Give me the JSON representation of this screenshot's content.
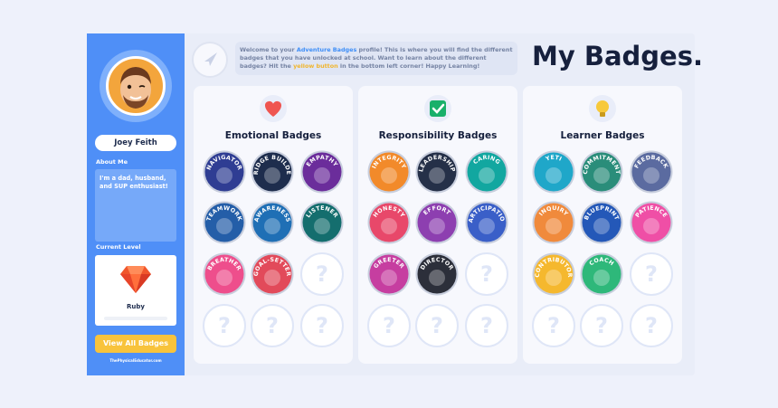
{
  "sidebar": {
    "user_name": "Joey Feith",
    "about_label": "About Me",
    "about_text": "I'm a dad, husband, and SUP enthusiast!",
    "level_label": "Current Level",
    "level_name": "Ruby",
    "level_progress": 0,
    "view_button": "View All Badges",
    "footer": "ThePhysicalEducator.com"
  },
  "header": {
    "welcome_1": "Welcome to your ",
    "welcome_link": "Adventure Badges",
    "welcome_2": " profile! This is where you will find the different badges that you have unlocked at school. Want to learn about the different badges? Hit the ",
    "welcome_button": "yellow button",
    "welcome_3": " in the bottom left corner! Happy Learning!",
    "title": "My Badges."
  },
  "categories": [
    {
      "title": "Emotional Badges",
      "icon": "heart-icon",
      "badges": [
        {
          "label": "NAVIGATOR",
          "color": "#2f3d93",
          "locked": false
        },
        {
          "label": "BRIDGE BUILDER",
          "color": "#1e2d4d",
          "locked": false
        },
        {
          "label": "EMPATHY",
          "color": "#6b2d9b",
          "locked": false
        },
        {
          "label": "TEAMWORK",
          "color": "#245ea8",
          "locked": false
        },
        {
          "label": "AWARENESS",
          "color": "#1f6fb5",
          "locked": false
        },
        {
          "label": "LISTENER",
          "color": "#146e6e",
          "locked": false
        },
        {
          "label": "BREATHER",
          "color": "#ee4e8c",
          "locked": false
        },
        {
          "label": "GOAL-SETTER",
          "color": "#e24a5a",
          "locked": false
        },
        {
          "label": "",
          "color": "",
          "locked": true
        },
        {
          "label": "",
          "color": "",
          "locked": true
        },
        {
          "label": "",
          "color": "",
          "locked": true
        },
        {
          "label": "",
          "color": "",
          "locked": true
        }
      ]
    },
    {
      "title": "Responsibility Badges",
      "icon": "checkmark-icon",
      "badges": [
        {
          "label": "INTEGRITY",
          "color": "#f28a2a",
          "locked": false
        },
        {
          "label": "LEADERSHIP",
          "color": "#253048",
          "locked": false
        },
        {
          "label": "CARING",
          "color": "#12a7a0",
          "locked": false
        },
        {
          "label": "HONESTY",
          "color": "#e8486a",
          "locked": false
        },
        {
          "label": "EFFORT",
          "color": "#8d3fb0",
          "locked": false
        },
        {
          "label": "PARTICIPATION",
          "color": "#3a5fc8",
          "locked": false
        },
        {
          "label": "GREETER",
          "color": "#c63ea0",
          "locked": false
        },
        {
          "label": "DIRECTOR",
          "color": "#2c2f3a",
          "locked": false
        },
        {
          "label": "",
          "color": "",
          "locked": true
        },
        {
          "label": "",
          "color": "",
          "locked": true
        },
        {
          "label": "",
          "color": "",
          "locked": true
        },
        {
          "label": "",
          "color": "",
          "locked": true
        }
      ]
    },
    {
      "title": "Learner Badges",
      "icon": "lightbulb-icon",
      "badges": [
        {
          "label": "YETI",
          "color": "#1fa7c9",
          "locked": false
        },
        {
          "label": "COMMITMENT",
          "color": "#2a8d7a",
          "locked": false
        },
        {
          "label": "FEEDBACK",
          "color": "#5b6ba0",
          "locked": false
        },
        {
          "label": "INQUIRY",
          "color": "#f08a3c",
          "locked": false
        },
        {
          "label": "BLUEPRINT",
          "color": "#2458b8",
          "locked": false
        },
        {
          "label": "PATIENCE",
          "color": "#ef4fa6",
          "locked": false
        },
        {
          "label": "CONTRIBUTOR",
          "color": "#f5b82e",
          "locked": false
        },
        {
          "label": "COACH",
          "color": "#2eb87a",
          "locked": false
        },
        {
          "label": "",
          "color": "",
          "locked": true
        },
        {
          "label": "",
          "color": "",
          "locked": true
        },
        {
          "label": "",
          "color": "",
          "locked": true
        },
        {
          "label": "",
          "color": "",
          "locked": true
        }
      ]
    }
  ],
  "colors": {
    "sidebar": "#4f8ff7",
    "accent_yellow": "#f8c33c",
    "title": "#16203d",
    "locked_badge": "#dfe6f7"
  }
}
